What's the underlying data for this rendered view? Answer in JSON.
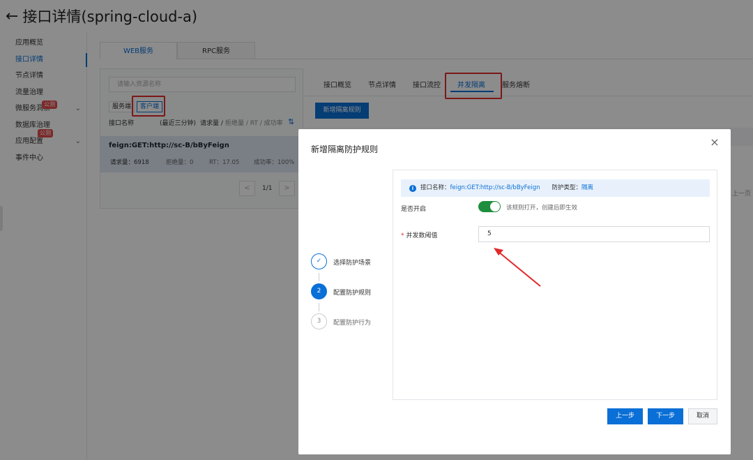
{
  "header": {
    "back": "←",
    "title": "接口详情(spring-cloud-a)"
  },
  "sidebar": {
    "items": [
      {
        "label": "应用概览"
      },
      {
        "label": "接口详情"
      },
      {
        "label": "节点详情"
      },
      {
        "label": "流量治理"
      },
      {
        "label": "微服务洞察",
        "badge": "公测",
        "chevron": "⌄"
      },
      {
        "label": "数据库治理"
      },
      {
        "label": "应用配置",
        "badge": "公测",
        "chevron": "⌄"
      },
      {
        "label": "事件中心"
      }
    ]
  },
  "service_tabs": [
    "WEB服务",
    "RPC服务"
  ],
  "left_panel": {
    "search_placeholder": "请输入资源名称",
    "segments": [
      "服务端",
      "客户端"
    ],
    "columns": {
      "name": "接口名称",
      "window": "(最近三分钟)",
      "metrics_main": "请求量 /",
      "metrics_rest": "拒绝量 / RT / 成功率"
    },
    "row": {
      "name": "feign:GET:http://sc-B/bByFeign",
      "requests": "请求量：6918",
      "rejected": "拒绝量：0",
      "rt": "RT：17.05",
      "success": "成功率：100%"
    },
    "pager": {
      "prev": "<",
      "text": "1/1",
      "next": ">"
    }
  },
  "right_tabs": [
    "接口概览",
    "节点详情",
    "接口流控",
    "并发隔离",
    "服务熔断"
  ],
  "add_rule_button": "新增隔离规则",
  "bg_right": {
    "pager_prev": "上一页"
  },
  "dialog": {
    "title": "新增隔离防护规则",
    "close": "×",
    "steps": [
      {
        "num": "✓",
        "label": "选择防护场景"
      },
      {
        "num": "2",
        "label": "配置防护规则"
      },
      {
        "num": "3",
        "label": "配置防护行为"
      }
    ],
    "info": {
      "icon": "i",
      "name_label": "接口名称：",
      "name_value": "feign:GET:http://sc-B/bByFeign",
      "type_label": "防护类型：",
      "type_value": "隔离"
    },
    "enable": {
      "label": "是否开启",
      "on": true,
      "help": "该规则打开，创建后即生效"
    },
    "threshold": {
      "required": "*",
      "label": "并发数阈值",
      "value": "5"
    },
    "buttons": {
      "prev": "上一步",
      "next": "下一步",
      "cancel": "取消"
    }
  },
  "colors": {
    "primary": "#0a6fd6",
    "switch_on": "#1e8e3e",
    "annotation": "#e12a2a"
  }
}
